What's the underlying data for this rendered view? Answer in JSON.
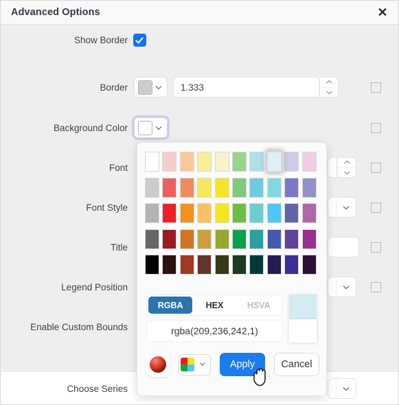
{
  "window": {
    "title": "Advanced Options",
    "close_icon": "close-icon",
    "close_label": "✕"
  },
  "form": {
    "rows": [
      {
        "label": "Show Border",
        "control": "checkbox-checked"
      },
      {
        "label": "Border",
        "control": "color-and-number",
        "value": "1.333"
      },
      {
        "label": "Background Color",
        "control": "color-swatch-focused"
      },
      {
        "label": "Font",
        "control": "number-spinner"
      },
      {
        "label": "Font Style",
        "control": "select"
      },
      {
        "label": "Title",
        "control": "text-input",
        "value": ""
      },
      {
        "label": "Legend Position",
        "control": "select"
      },
      {
        "label": "Enable Custom Bounds",
        "control": "none"
      },
      {
        "label": "Choose Series",
        "control": "select"
      }
    ]
  },
  "picker": {
    "tabs": [
      {
        "label": "RGBA",
        "state": "active"
      },
      {
        "label": "HEX",
        "state": "normal"
      },
      {
        "label": "HSVA",
        "state": "muted"
      }
    ],
    "value": "rgba(209,236,242,1)",
    "preview_color": "#d1ecf2",
    "preview_alpha_color": "#ffffff",
    "selected_swatch_index": 7,
    "apply_label": "Apply",
    "cancel_label": "Cancel",
    "sphere_icon": "gradient-sphere-icon",
    "quad_icon": "palette-quad-icon",
    "palette": [
      [
        "#ffffff",
        "#f7cccc",
        "#fac99a",
        "#f8ee9a",
        "#f8f3ca",
        "#99d48a",
        "#ade0e8",
        "#dcf0f6",
        "#cccce8",
        "#efcee4"
      ],
      [
        "#cccccc",
        "#ef5f5f",
        "#f38a5f",
        "#f5e85f",
        "#f5e52a",
        "#7ecb7c",
        "#6fcbdd",
        "#84d7e0",
        "#7d77c8",
        "#9191ca"
      ],
      [
        "#b3b3b3",
        "#ee2026",
        "#f4911e",
        "#fbc161",
        "#f5e621",
        "#6cbe45",
        "#6ccdcd",
        "#4fc6f4",
        "#6263ae",
        "#b267aa"
      ],
      [
        "#666666",
        "#9c1b21",
        "#d1761f",
        "#ccа040",
        "#9aa532",
        "#0ba04a",
        "#2ba0a0",
        "#4758ac",
        "#64419c",
        "#9b2e91"
      ],
      [
        "#000000",
        "#2d110e",
        "#a43822",
        "#66342f",
        "#36381a",
        "#1d3b1e",
        "#023a3c",
        "#231d52",
        "#3c2e97",
        "#2e1035"
      ]
    ],
    "palette_row4_fixed": [
      "#666666",
      "#9c1b21",
      "#d1761f",
      "#cca040",
      "#9aa532",
      "#0ba04a",
      "#2ba0a0",
      "#4758ac",
      "#64419c",
      "#9b2e91"
    ]
  },
  "colors": {
    "accent_blue": "#1b7cf0",
    "tab_active_blue": "#2b74ad",
    "checkbox_blue": "#1271f2",
    "body_bg": "#eeeeee",
    "border_swatch": "#cccccc",
    "background_swatch": "#ffffff"
  }
}
